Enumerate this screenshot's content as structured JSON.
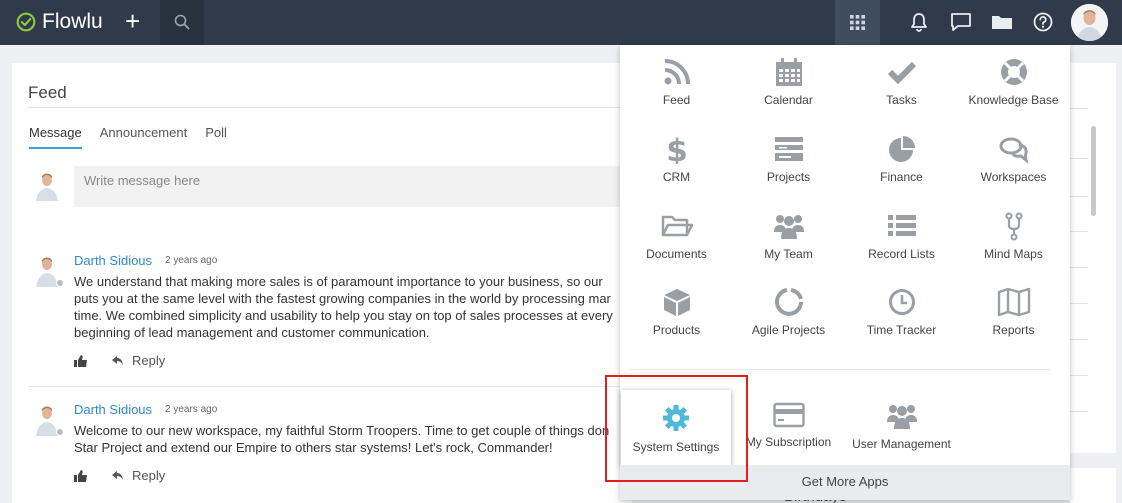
{
  "topbar": {
    "logo_text": "Flowlu"
  },
  "feed": {
    "title": "Feed",
    "tabs": [
      "Message",
      "Announcement",
      "Poll"
    ],
    "compose_placeholder": "Write message here",
    "posts": [
      {
        "author": "Darth Sidious",
        "time": "2 years ago",
        "lines": [
          "We understand that making more sales is of paramount importance to your business, so our",
          "puts you at the same level with the fastest growing companies in the world by processing mar",
          "time. We combined simplicity and usability to help you stay on top of sales processes at every",
          "beginning of lead management and customer communication."
        ],
        "reply_label": "Reply"
      },
      {
        "author": "Darth Sidious",
        "time": "2 years ago",
        "lines": [
          "Welcome to our new workspace, my faithful Storm Troopers. Time to get couple of things don",
          "Star Project and extend our Empire to others star systems! Let's rock, Commander!"
        ],
        "reply_label": "Reply"
      }
    ]
  },
  "app_menu": {
    "apps": [
      {
        "label": "Feed",
        "icon": "rss-icon"
      },
      {
        "label": "Calendar",
        "icon": "calendar-icon"
      },
      {
        "label": "Tasks",
        "icon": "check-icon"
      },
      {
        "label": "Knowledge Base",
        "icon": "lifebuoy-icon"
      },
      {
        "label": "CRM",
        "icon": "dollar-icon"
      },
      {
        "label": "Projects",
        "icon": "projects-icon"
      },
      {
        "label": "Finance",
        "icon": "pie-chart-icon"
      },
      {
        "label": "Workspaces",
        "icon": "chat-bubbles-icon"
      },
      {
        "label": "Documents",
        "icon": "folder-icon"
      },
      {
        "label": "My Team",
        "icon": "team-icon"
      },
      {
        "label": "Record Lists",
        "icon": "list-icon"
      },
      {
        "label": "Mind Maps",
        "icon": "branch-icon"
      },
      {
        "label": "Products",
        "icon": "cube-icon"
      },
      {
        "label": "Agile Projects",
        "icon": "ring-icon"
      },
      {
        "label": "Time Tracker",
        "icon": "clock-icon"
      },
      {
        "label": "Reports",
        "icon": "map-icon"
      }
    ],
    "admin": [
      {
        "label": "System Settings",
        "icon": "gear-icon"
      },
      {
        "label": "My Subscription",
        "icon": "credit-card-icon"
      },
      {
        "label": "User Management",
        "icon": "users-icon"
      }
    ],
    "get_more": "Get More Apps"
  },
  "right_widget": {
    "title": "Birthdays"
  },
  "colors": {
    "topbar": "#2f3b4a",
    "accent": "#3aa0d8",
    "link": "#2d8bc9",
    "icon_gray": "#9a9fa6",
    "settings_icon": "#4fb8d8",
    "highlight": "#e31e1e"
  }
}
